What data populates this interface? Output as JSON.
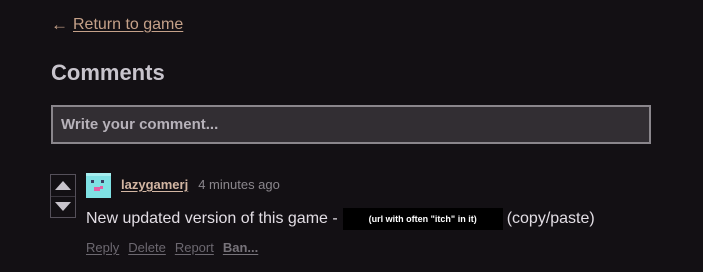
{
  "nav": {
    "return_arrow": "←",
    "return_label": "Return to game"
  },
  "comments": {
    "title": "Comments",
    "input_placeholder": "Write your comment..."
  },
  "comment": {
    "author": "lazygamerj",
    "time": "4 minutes ago",
    "text_before": "New updated version of this game -",
    "redaction_label": "(url with often \"itch\" in it)",
    "text_after": "(copy/paste)",
    "avatar_color": "#7fe1e4",
    "actions": {
      "reply": "Reply",
      "delete": "Delete",
      "report": "Report",
      "ban": "Ban..."
    }
  },
  "colors": {
    "background": "#131014",
    "link": "#c5a189",
    "author": "#d3b6a3",
    "muted": "#8a868c"
  },
  "icons": {
    "upvote": "triangle-up-icon",
    "downvote": "triangle-down-icon",
    "back": "left-arrow-icon"
  }
}
